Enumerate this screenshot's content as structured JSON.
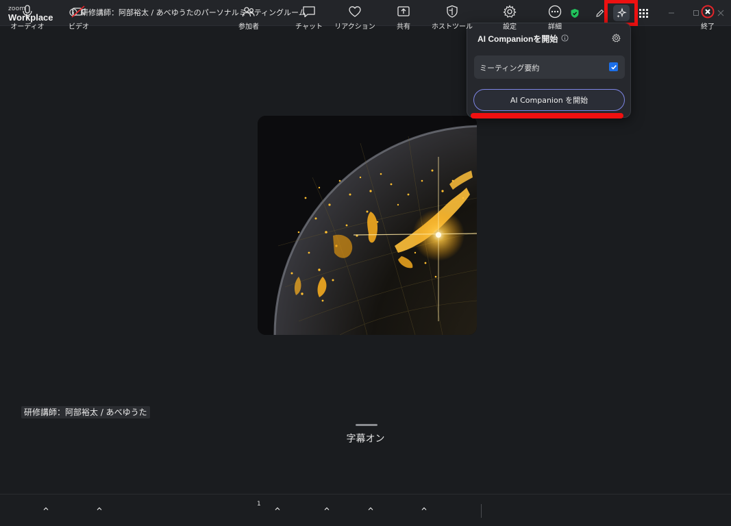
{
  "app": {
    "logo_small": "zoom",
    "logo_name": "Workplace",
    "meeting_title": "研修講師：阿部裕太 / あべゆうたのパーソナルミーティングルーム"
  },
  "titlebar_icons": [
    "info-icon",
    "shield-check-icon",
    "edit-pen-icon",
    "ai-companion-sparkle-icon",
    "apps-grid-icon",
    "minimize-icon",
    "maximize-icon",
    "close-icon"
  ],
  "ai_panel": {
    "title": "AI Companionを開始",
    "option_label": "ミーティング要約",
    "option_checked": true,
    "start_button": "AI Companion を開始"
  },
  "participant": {
    "name": "研修講師：阿部裕太 / あべゆうた"
  },
  "captions": {
    "text": "字幕オン"
  },
  "toolbar": {
    "audio": "オーディオ",
    "video": "ビデオ",
    "participants": "参加者",
    "participants_count": "1",
    "chat": "チャット",
    "reactions": "リアクション",
    "share": "共有",
    "host_tools": "ホストツール",
    "settings": "設定",
    "more": "詳細",
    "end": "終了"
  },
  "colors": {
    "accent_blue": "#1c6fe8",
    "highlight_red": "#ee1111",
    "shield_green": "#22c55e",
    "end_red": "#e5252a"
  }
}
